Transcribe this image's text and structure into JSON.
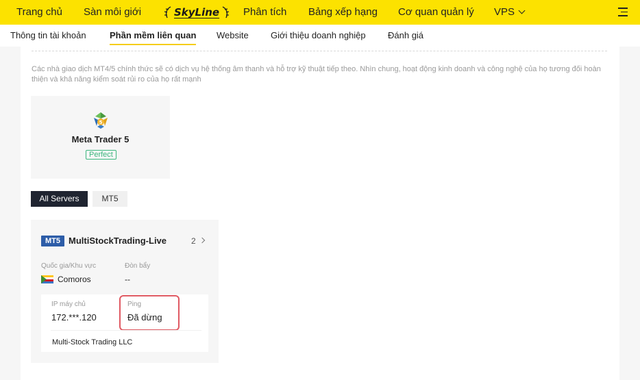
{
  "topnav": {
    "items": [
      "Trang chủ",
      "Sàn môi giới",
      "Phân tích",
      "Bảng xếp hạng",
      "Cơ quan quản lý",
      "VPS"
    ],
    "logo_text": "SkyLine"
  },
  "subnav": {
    "tabs": [
      "Thông tin tài khoản",
      "Phần mềm liên quan",
      "Website",
      "Giới thiệu doanh nghiệp",
      "Đánh giá"
    ]
  },
  "description": "Các nhà giao dịch MT4/5 chính thức sẽ có dịch vụ hệ thống âm thanh và hỗ trợ kỹ thuật tiếp theo. Nhìn chung, hoạt động kinh doanh và công nghệ của họ tương đối hoàn thiện và khả năng kiểm soát rủi ro của họ rất mạnh",
  "software": {
    "name": "Meta Trader 5",
    "badge": "Perfect"
  },
  "filters": [
    "All Servers",
    "MT5"
  ],
  "server": {
    "type_badge": "MT5",
    "name": "MultiStockTrading-Live",
    "count": "2",
    "country_label": "Quốc gia/Khu vực",
    "country": "Comoros",
    "leverage_label": "Đòn bẩy",
    "leverage": "--",
    "ip_label": "IP máy chủ",
    "ip": "172.***.120",
    "ping_label": "Ping",
    "ping": "Đã dừng",
    "company": "Multi-Stock Trading LLC"
  },
  "colors": {
    "nav_bg": "#fce200",
    "active_underline": "#f5cd19",
    "badge_green": "#3bb77e",
    "mt5_badge": "#2d5da8",
    "highlight": "#e05a63"
  }
}
